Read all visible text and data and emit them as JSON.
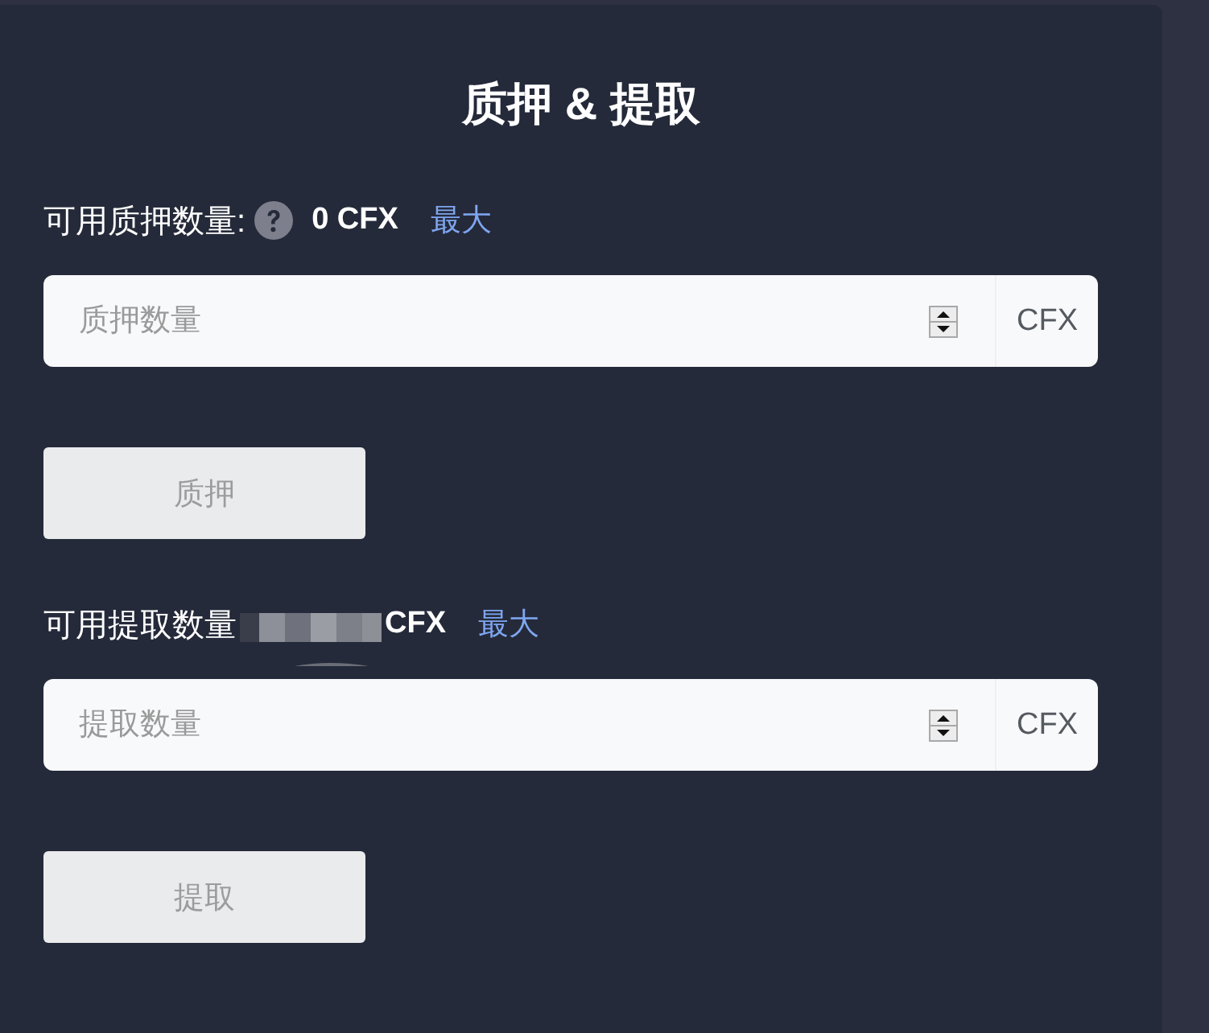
{
  "title": "质押 & 提取",
  "sections": [
    {
      "label": "可用质押数量:",
      "help_icon": true,
      "redacted": false,
      "amount": "0 CFX",
      "max_link": "最大",
      "input": {
        "placeholder": "质押数量",
        "unit": "CFX"
      },
      "button": {
        "label": "质押",
        "disabled": true
      }
    },
    {
      "label": "可用提取数量",
      "help_icon": false,
      "redacted": true,
      "amount": "CFX",
      "max_link": "最大",
      "input": {
        "placeholder": "提取数量",
        "unit": "CFX"
      },
      "button": {
        "label": "提取",
        "disabled": true
      }
    }
  ]
}
